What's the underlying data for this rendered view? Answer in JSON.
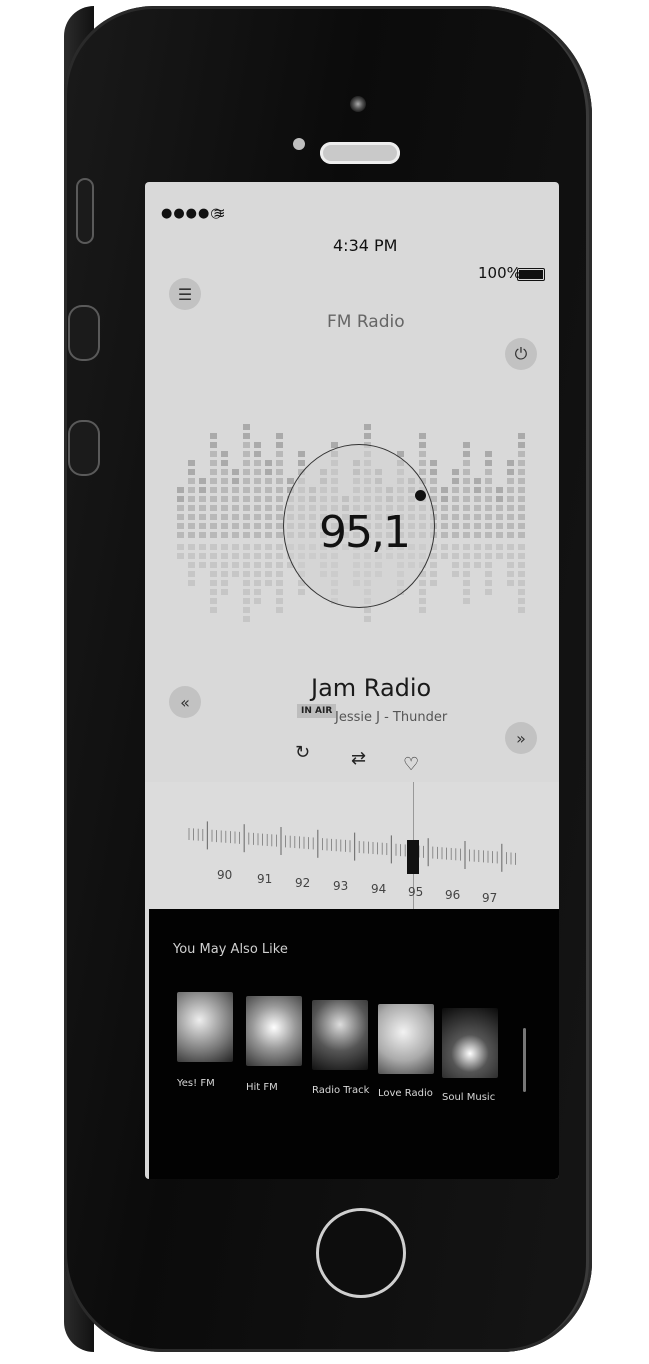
{
  "status": {
    "signal": "●●●●○",
    "time": "4:34 PM",
    "battery": "100%"
  },
  "icons": {
    "menu": "☰",
    "power": "⏻",
    "rewind": "«",
    "forward": "»",
    "repeat": "↻",
    "share": "⇄",
    "heart": "♡",
    "wifi": "≋"
  },
  "header": {
    "title": "FM Radio"
  },
  "tuner": {
    "frequency": "95,1"
  },
  "now_playing": {
    "station": "Jam Radio",
    "badge": "IN AIR",
    "song": "Jessie J - Thunder"
  },
  "dial_labels": [
    "90",
    "91",
    "92",
    "93",
    "94",
    "95",
    "96",
    "97"
  ],
  "recommendations": {
    "title": "You May Also Like",
    "items": [
      {
        "label": "Yes! FM"
      },
      {
        "label": "Hit FM"
      },
      {
        "label": "Radio Track"
      },
      {
        "label": "Love Radio"
      },
      {
        "label": "Soul Music"
      }
    ]
  }
}
